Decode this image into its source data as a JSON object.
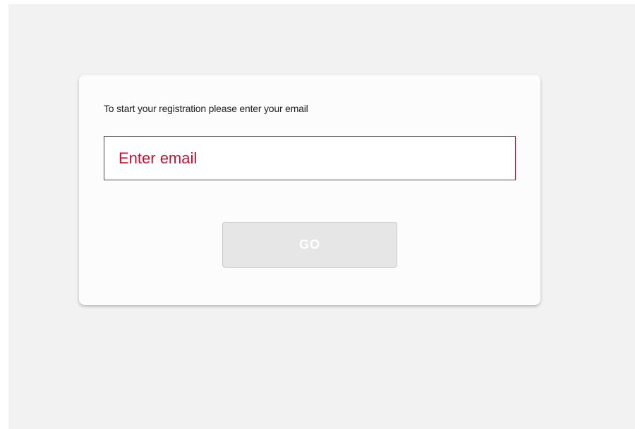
{
  "registration": {
    "prompt": "To start your registration please enter your email",
    "email_placeholder": "Enter email",
    "email_value": "",
    "go_label": "GO"
  },
  "colors": {
    "accent": "#c8102e",
    "page_background": "#f2f2f2",
    "card_background": "#fcfcfc",
    "button_disabled": "#e6e6e6"
  }
}
